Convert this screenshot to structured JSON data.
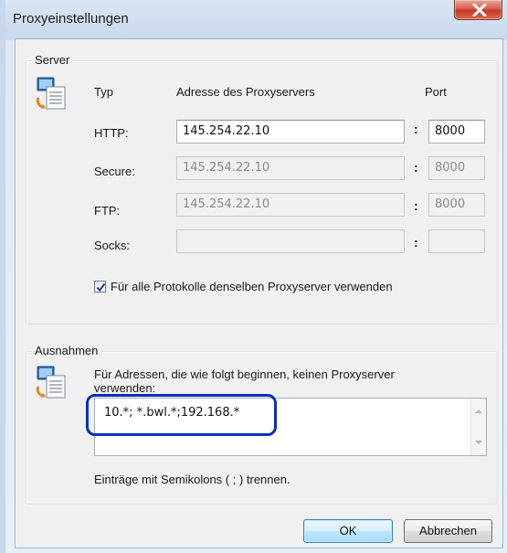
{
  "window": {
    "title": "Proxyeinstellungen"
  },
  "server": {
    "group_title": "Server",
    "headers": {
      "type": "Typ",
      "address": "Adresse des Proxyservers",
      "port": "Port"
    },
    "colon": ":",
    "rows": [
      {
        "label": "HTTP:",
        "address": "145.254.22.10",
        "port": "8000",
        "enabled": true
      },
      {
        "label": "Secure:",
        "address": "145.254.22.10",
        "port": "8000",
        "enabled": false
      },
      {
        "label": "FTP:",
        "address": "145.254.22.10",
        "port": "8000",
        "enabled": false
      },
      {
        "label": "Socks:",
        "address": "",
        "port": "",
        "enabled": false
      }
    ],
    "same_proxy_checkbox": {
      "label": "Für alle Protokolle denselben Proxyserver verwenden",
      "checked": true
    }
  },
  "exceptions": {
    "group_title": "Ausnahmen",
    "description": "Für Adressen, die wie folgt beginnen, keinen Proxyserver verwenden:",
    "description_line1": "Für Adressen, die wie folgt beginnen, keinen Proxyserver",
    "description_line2": "verwenden:",
    "value": "10.*; *.bwl.*;192.168.*",
    "hint": "Einträge mit Semikolons ( ; ) trennen."
  },
  "buttons": {
    "ok": "OK",
    "cancel": "Abbrechen"
  },
  "icons": {
    "close": "close-icon",
    "server_group": "network-settings-icon",
    "exceptions_group": "network-settings-icon",
    "check": "checkmark-icon"
  },
  "colors": {
    "highlight": "#0b2fb8",
    "close_button": "#c4381f",
    "default_button": "#3c7fb1"
  }
}
